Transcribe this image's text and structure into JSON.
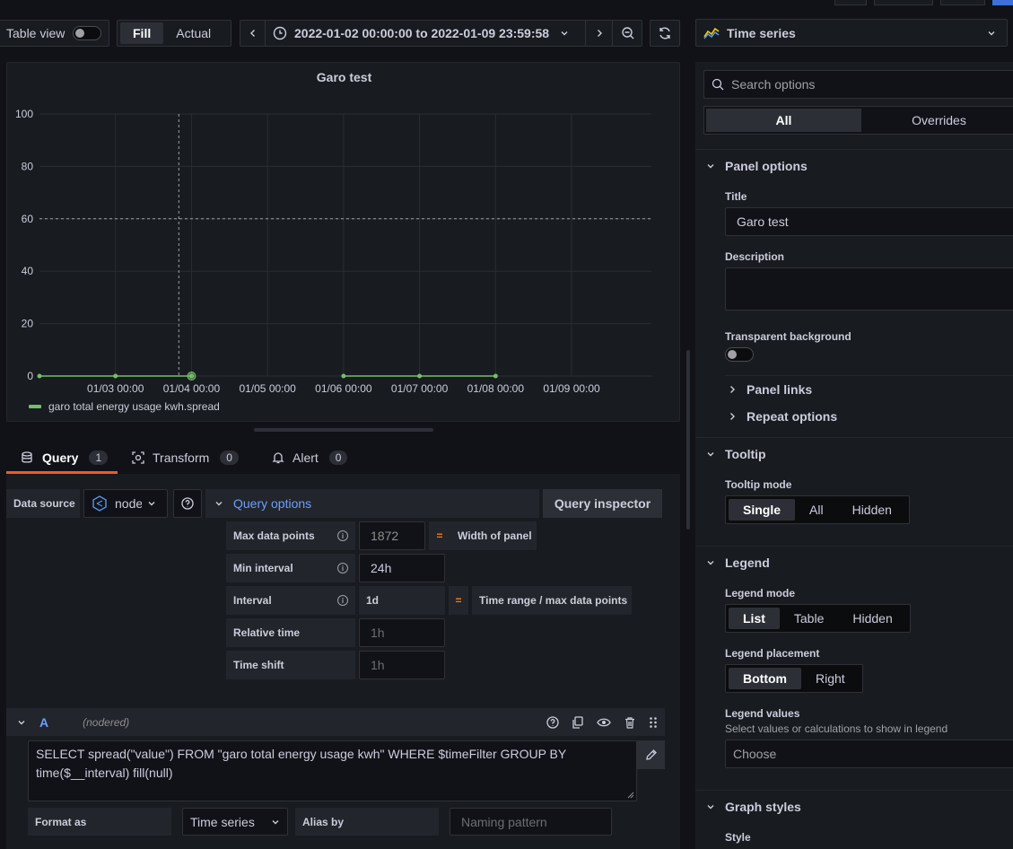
{
  "toolbar": {
    "table_view_label": "Table view",
    "fill_label": "Fill",
    "actual_label": "Actual",
    "time_range": "2022-01-02 00:00:00 to 2022-01-09 23:59:58",
    "viz_type": "Time series"
  },
  "panel": {
    "title": "Garo test",
    "legend_label": "garo total energy usage kwh.spread",
    "line_color": "#73bf69"
  },
  "chart_data": {
    "type": "line",
    "x": [
      "01/03 00:00",
      "01/04 00:00",
      "01/05 00:00",
      "01/06 00:00",
      "01/07 00:00",
      "01/08 00:00",
      "01/09 00:00"
    ],
    "y_ticks": [
      0,
      20,
      40,
      60,
      80,
      100
    ],
    "ylim": [
      0,
      100
    ],
    "threshold_line": 60,
    "cursor_at": "01/03 20:00",
    "series": [
      {
        "name": "garo total energy usage kwh.spread",
        "points": [
          {
            "t": "01/02 00:00",
            "v": 0
          },
          {
            "t": "01/03 00:00",
            "v": 0
          },
          {
            "t": "01/04 00:00",
            "v": 0
          },
          {
            "t": "01/06 00:00",
            "v": 0
          },
          {
            "t": "01/07 00:00",
            "v": 0
          },
          {
            "t": "01/08 00:00",
            "v": 0
          }
        ]
      }
    ]
  },
  "tabs": [
    {
      "label": "Query",
      "count": "1"
    },
    {
      "label": "Transform",
      "count": "0"
    },
    {
      "label": "Alert",
      "count": "0"
    }
  ],
  "query": {
    "data_source_label": "Data source",
    "data_source_value": "node",
    "query_options_label": "Query options",
    "inspector_label": "Query inspector",
    "max_points_label": "Max data points",
    "max_points_value": "1872",
    "eq": "=",
    "width_of_panel": "Width of panel",
    "min_interval_label": "Min interval",
    "min_interval_value": "24h",
    "interval_label": "Interval",
    "interval_value": "1d",
    "interval_desc": "Time range / max data points",
    "relative_time_label": "Relative time",
    "relative_time_placeholder": "1h",
    "time_shift_label": "Time shift",
    "time_shift_placeholder": "1h",
    "row_letter": "A",
    "row_source": "(nodered)",
    "sql_line1": "SELECT spread(\"value\") FROM \"garo total energy usage kwh\" WHERE $timeFilter GROUP BY",
    "sql_line2": "time($__interval) fill(null)",
    "format_as_label": "Format as",
    "format_as_value": "Time series",
    "alias_by_label": "Alias by",
    "alias_placeholder": "Naming pattern"
  },
  "options": {
    "search_placeholder": "Search options",
    "all_label": "All",
    "overrides_label": "Overrides",
    "panel_options": "Panel options",
    "title_label": "Title",
    "title_value": "Garo test",
    "description_label": "Description",
    "transparent_label": "Transparent background",
    "panel_links": "Panel links",
    "repeat_options": "Repeat options",
    "tooltip": "Tooltip",
    "tooltip_mode": "Tooltip mode",
    "tooltip_opts": [
      "Single",
      "All",
      "Hidden"
    ],
    "legend": "Legend",
    "legend_mode": "Legend mode",
    "legend_mode_opts": [
      "List",
      "Table",
      "Hidden"
    ],
    "legend_placement": "Legend placement",
    "legend_placement_opts": [
      "Bottom",
      "Right"
    ],
    "legend_values": "Legend values",
    "legend_values_desc": "Select values or calculations to show in legend",
    "choose_placeholder": "Choose",
    "graph_styles": "Graph styles",
    "style_label": "Style"
  }
}
